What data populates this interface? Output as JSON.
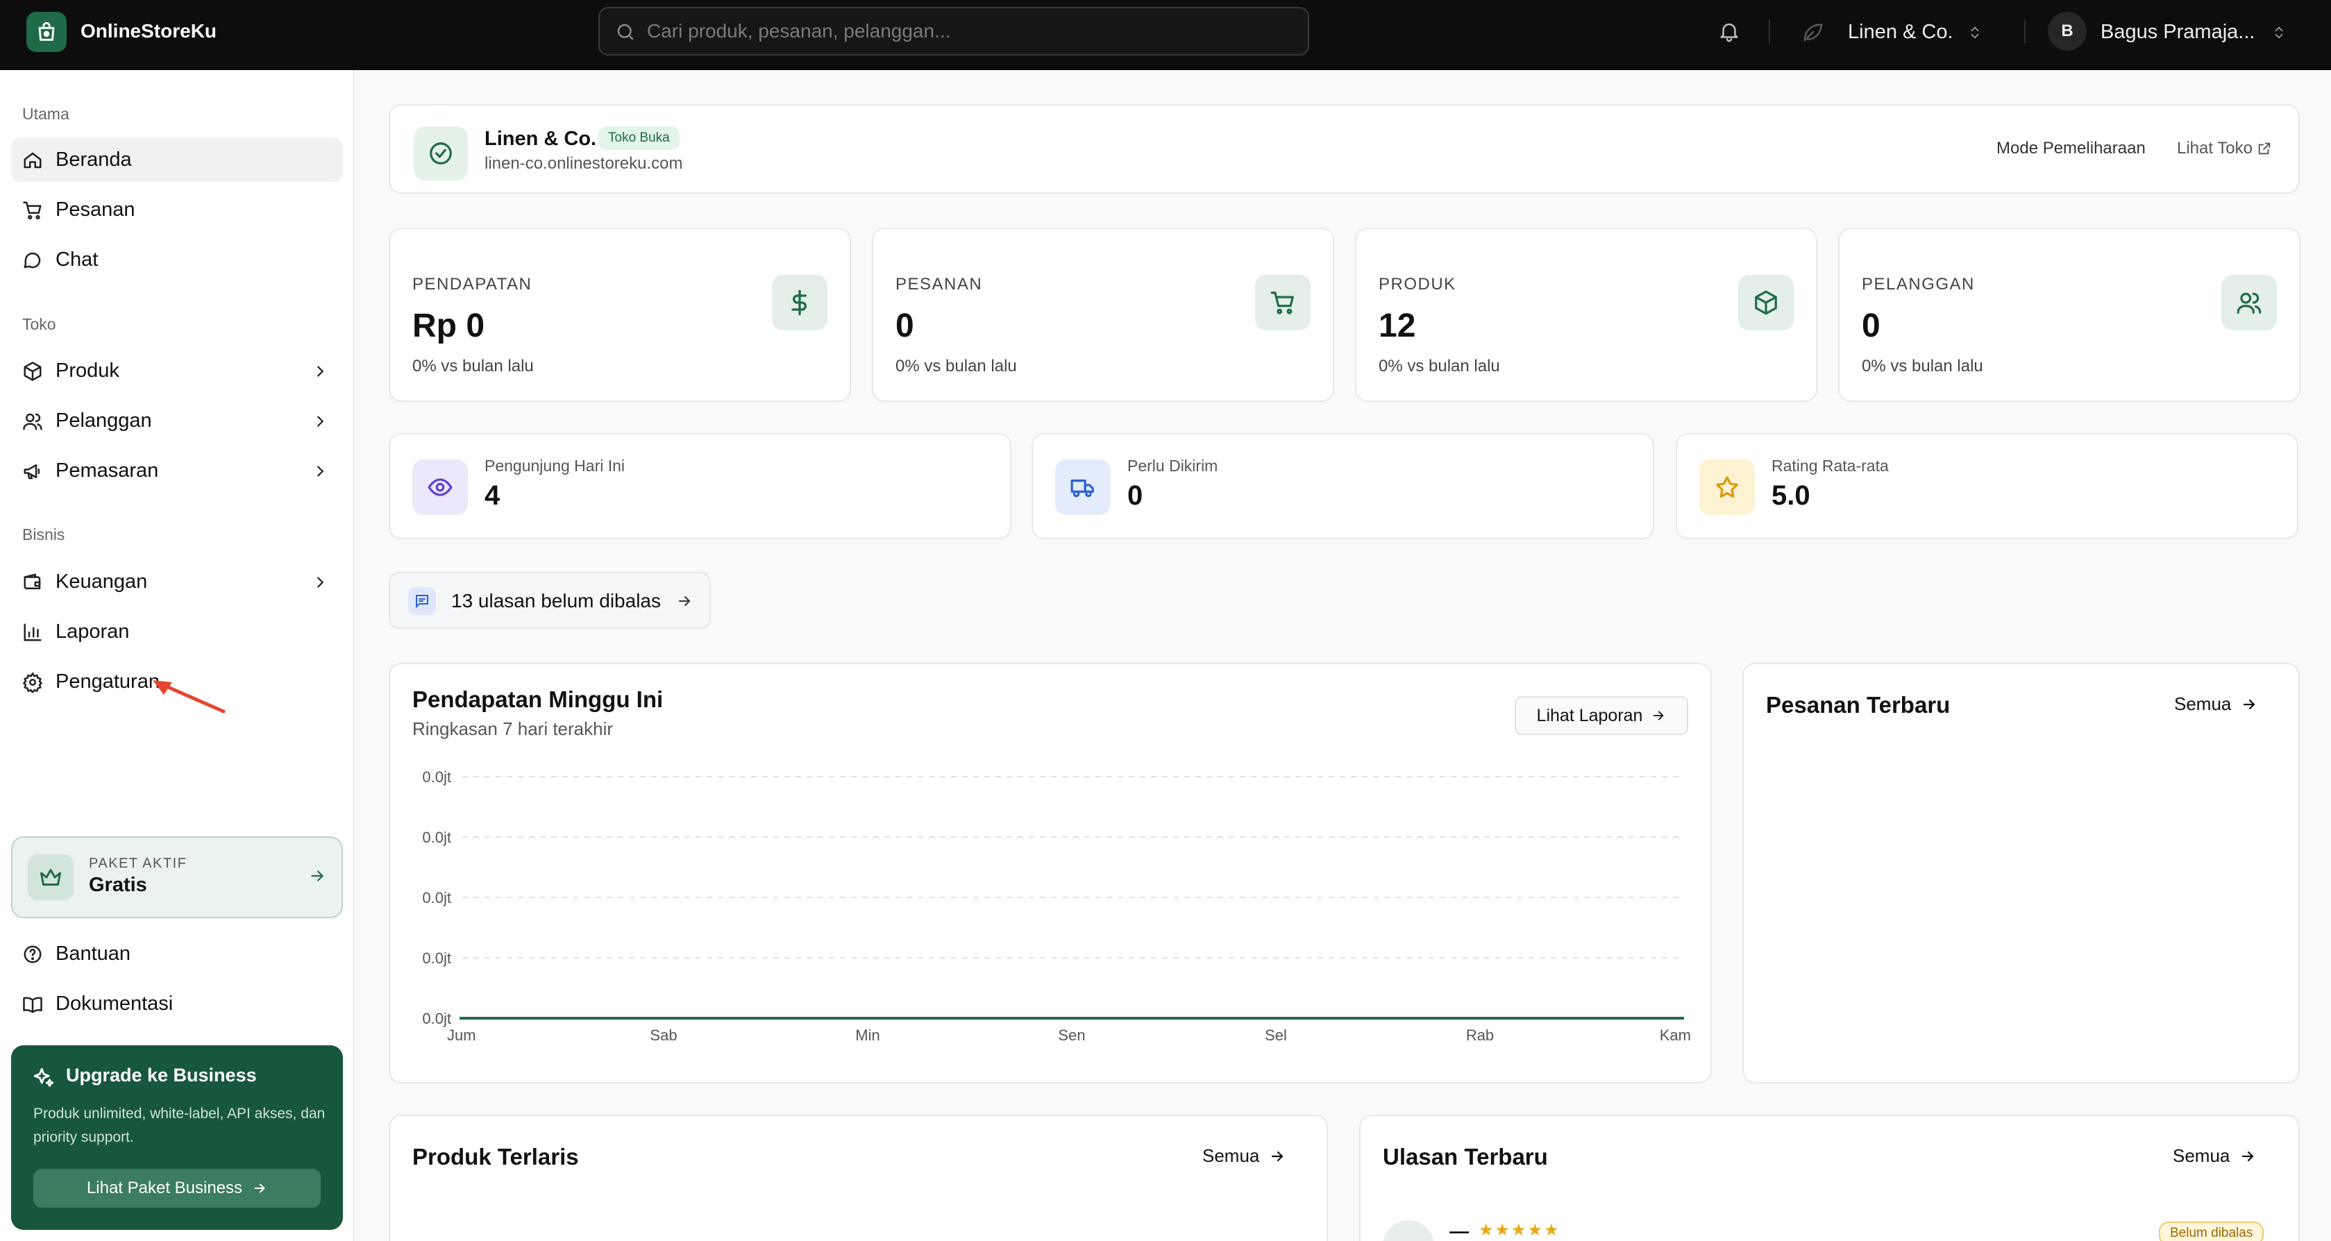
{
  "app": {
    "brand": "OnlineStoreKu",
    "search_placeholder": "Cari produk, pesanan, pelanggan...",
    "store_switcher": "Linen & Co.",
    "user": {
      "initial": "B",
      "name": "Bagus Pramaja..."
    }
  },
  "sidebar": {
    "sections": [
      {
        "title": "Utama",
        "items": [
          {
            "label": "Beranda",
            "icon": "home-icon",
            "active": true
          },
          {
            "label": "Pesanan",
            "icon": "cart-icon"
          },
          {
            "label": "Chat",
            "icon": "chat-icon"
          }
        ]
      },
      {
        "title": "Toko",
        "items": [
          {
            "label": "Produk",
            "icon": "box-icon",
            "has_children": true
          },
          {
            "label": "Pelanggan",
            "icon": "users-icon",
            "has_children": true
          },
          {
            "label": "Pemasaran",
            "icon": "megaphone-icon",
            "has_children": true
          }
        ]
      },
      {
        "title": "Bisnis",
        "items": [
          {
            "label": "Keuangan",
            "icon": "wallet-icon",
            "has_children": true
          },
          {
            "label": "Laporan",
            "icon": "bar-chart-icon"
          },
          {
            "label": "Pengaturan",
            "icon": "gear-icon"
          }
        ]
      }
    ],
    "plan": {
      "label": "PAKET AKTIF",
      "value": "Gratis"
    },
    "footer_links": [
      {
        "label": "Bantuan",
        "icon": "help-icon"
      },
      {
        "label": "Dokumentasi",
        "icon": "book-icon"
      }
    ],
    "upgrade": {
      "title": "Upgrade ke Business",
      "description": "Produk unlimited, white-label, API akses, dan priority support.",
      "button": "Lihat Paket Business"
    }
  },
  "store_card": {
    "name": "Linen & Co.",
    "status": "Toko Buka",
    "url": "linen-co.onlinestoreku.com",
    "maintenance": "Mode Pemeliharaan",
    "view_store": "Lihat Toko"
  },
  "stats": [
    {
      "label": "PENDAPATAN",
      "value": "Rp 0",
      "delta": "0% vs bulan lalu",
      "icon": "dollar-icon"
    },
    {
      "label": "PESANAN",
      "value": "0",
      "delta": "0% vs bulan lalu",
      "icon": "cart-icon"
    },
    {
      "label": "PRODUK",
      "value": "12",
      "delta": "0% vs bulan lalu",
      "icon": "box-icon"
    },
    {
      "label": "PELANGGAN",
      "value": "0",
      "delta": "0% vs bulan lalu",
      "icon": "users-icon"
    }
  ],
  "mini_stats": [
    {
      "label": "Pengunjung Hari Ini",
      "value": "4",
      "icon": "eye-icon",
      "bg": "#ece7fb",
      "color": "#5b3fd6"
    },
    {
      "label": "Perlu Dikirim",
      "value": "0",
      "icon": "truck-icon",
      "bg": "#e3ecfb",
      "color": "#2d5fd3"
    },
    {
      "label": "Rating Rata-rata",
      "value": "5.0",
      "icon": "star-icon",
      "bg": "#fdf2d2",
      "color": "#d99a0b"
    }
  ],
  "reviews_pending": "13 ulasan belum dibalas",
  "revenue_chart": {
    "title": "Pendapatan Minggu Ini",
    "subtitle": "Ringkasan 7 hari terakhir",
    "button": "Lihat Laporan"
  },
  "chart_data": {
    "type": "line",
    "title": "Pendapatan Minggu Ini",
    "subtitle": "Ringkasan 7 hari terakhir",
    "categories": [
      "Jum",
      "Sab",
      "Min",
      "Sen",
      "Sel",
      "Rab",
      "Kam"
    ],
    "series": [
      {
        "values": [
          0,
          0,
          0,
          0,
          0,
          0,
          0
        ],
        "color": "#1f6b48"
      }
    ],
    "y_ticks": [
      "0.0jt",
      "0.0jt",
      "0.0jt",
      "0.0jt",
      "0.0jt"
    ],
    "grid": true,
    "xlabel": "",
    "ylabel": ""
  },
  "orders": {
    "title": "Pesanan Terbaru",
    "all": "Semua"
  },
  "best_products": {
    "title": "Produk Terlaris",
    "all": "Semua"
  },
  "recent_reviews": {
    "title": "Ulasan Terbaru",
    "all": "Semua",
    "first": {
      "name": "—",
      "stars": "★★★★★",
      "status": "Belum dibalas"
    }
  }
}
